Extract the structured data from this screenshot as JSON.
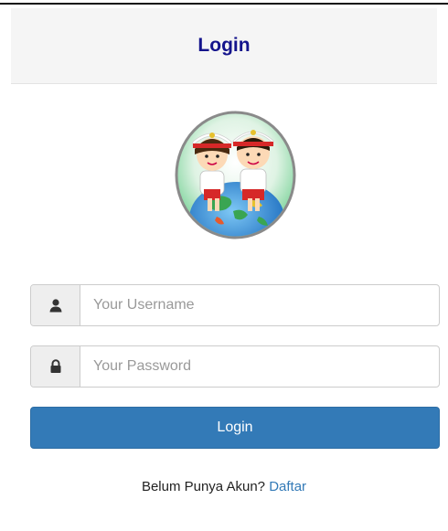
{
  "header": {
    "title": "Login"
  },
  "form": {
    "username": {
      "icon": "user-icon",
      "value": "",
      "placeholder": "Your Username"
    },
    "password": {
      "icon": "lock-icon",
      "value": "",
      "placeholder": "Your Password"
    },
    "submit_label": "Login"
  },
  "signup": {
    "prompt": "Belum Punya Akun?",
    "link_label": "Daftar"
  },
  "colors": {
    "header_title": "#14148c",
    "button": "#337ab7",
    "link": "#337ab7",
    "header_bg": "#f5f5f5"
  }
}
